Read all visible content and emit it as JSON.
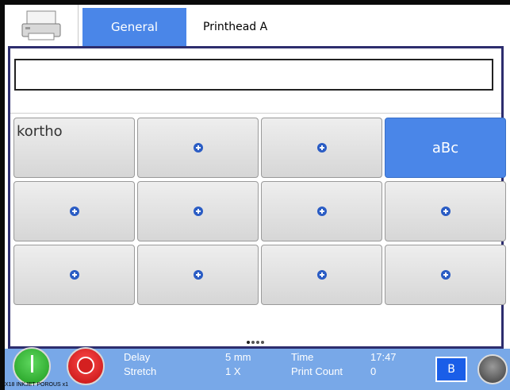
{
  "tabs": {
    "general_label": "General",
    "printhead_label": "Printhead A"
  },
  "editor": {
    "text_value": ""
  },
  "keys": [
    {
      "label": "kortho",
      "state": "filled"
    },
    {
      "label": "",
      "state": "empty"
    },
    {
      "label": "",
      "state": "empty"
    },
    {
      "label": "aBc",
      "state": "active"
    },
    {
      "label": "",
      "state": "empty"
    },
    {
      "label": "",
      "state": "empty"
    },
    {
      "label": "",
      "state": "empty"
    },
    {
      "label": "",
      "state": "empty"
    },
    {
      "label": "",
      "state": "empty"
    },
    {
      "label": "",
      "state": "empty"
    },
    {
      "label": "",
      "state": "empty"
    },
    {
      "label": "",
      "state": "empty"
    }
  ],
  "status": {
    "delay_label": "Delay",
    "delay_value": "5 mm",
    "stretch_label": "Stretch",
    "stretch_value": "1 X",
    "time_label": "Time",
    "time_value": "17:47",
    "print_count_label": "Print Count",
    "print_count_value": "0",
    "mode_button": "B",
    "footnote": "X18 INKJET POROUS x1"
  },
  "colors": {
    "accent": "#4a86e8",
    "statusbar": "#78a8e8",
    "frame": "#2d2d6e"
  }
}
